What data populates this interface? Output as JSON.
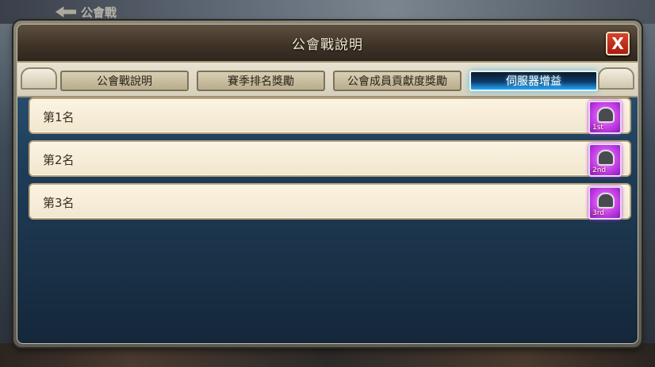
{
  "background": {
    "back_label": "公會戰"
  },
  "dialog": {
    "title": "公會戰說明",
    "close_label": "X"
  },
  "tabs": [
    {
      "label": "公會戰說明",
      "active": false
    },
    {
      "label": "賽季排名獎勵",
      "active": false
    },
    {
      "label": "公會成員貢獻度獎勵",
      "active": false
    },
    {
      "label": "伺服器增益",
      "active": true
    }
  ],
  "ranks": [
    {
      "label": "第1名",
      "badge": "1st"
    },
    {
      "label": "第2名",
      "badge": "2nd"
    },
    {
      "label": "第3名",
      "badge": "3rd"
    }
  ],
  "colors": {
    "active_tab_glow": "#21a8ff",
    "close_button": "#d8432d",
    "badge_purple": "#d24cf0"
  }
}
